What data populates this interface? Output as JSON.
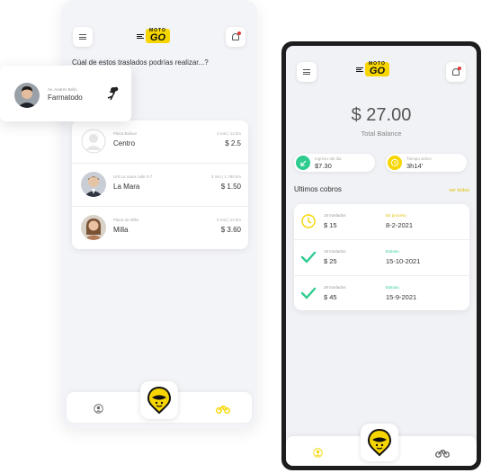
{
  "brand": {
    "name_top": "MOTO",
    "name_main": "GO",
    "accent": "#f7d600"
  },
  "back_phone": {
    "question": "Cúal de estos traslados podrías realizar...?",
    "trips": [
      {
        "address": "Plaza Bolivar",
        "name": "Centro",
        "meta": "3 min | 12 km",
        "price": "$ 2.5"
      },
      {
        "address": "Urb.La mara calle 3-7",
        "name": "La Mara",
        "meta": "3 min | 1.790 km",
        "price": "$ 1.50"
      },
      {
        "address": "Plaza de Milla",
        "name": "Milla",
        "meta": "2 min | 13 km",
        "price": "$ 3.60"
      }
    ]
  },
  "popup": {
    "address": "Av. Andres Bello",
    "name": "Farmatodo"
  },
  "front_phone": {
    "amount": "$ 27.00",
    "total_label": "Total Balance",
    "income_label": "Ingreso del dia",
    "income_value": "$7.30",
    "time_label": "Tiempo activo",
    "time_value": "3h14'",
    "section_title": "Ultimos cobros",
    "see_all": "ver todos",
    "payments": [
      {
        "count": "15 traslados",
        "amount": "$ 15",
        "status": "En proceso",
        "date": "8-2-2021",
        "kind": "pending"
      },
      {
        "count": "18 traslados",
        "amount": "$ 25",
        "status": "Exitoso",
        "date": "15-10-2021",
        "kind": "success"
      },
      {
        "count": "28 traslados",
        "amount": "$ 45",
        "status": "Exitoso",
        "date": "15-9-2021",
        "kind": "success"
      }
    ]
  },
  "colors": {
    "yellow": "#f7d600",
    "green": "#2ecc8f",
    "pending_text": "#e0c200",
    "success_text": "#2ecc8f"
  },
  "icons": [
    "menu-icon",
    "bell-icon",
    "user-icon",
    "motogo-helmet-icon",
    "motorcycle-icon",
    "arrow-down-left-icon",
    "clock-icon",
    "checkmark-icon"
  ]
}
